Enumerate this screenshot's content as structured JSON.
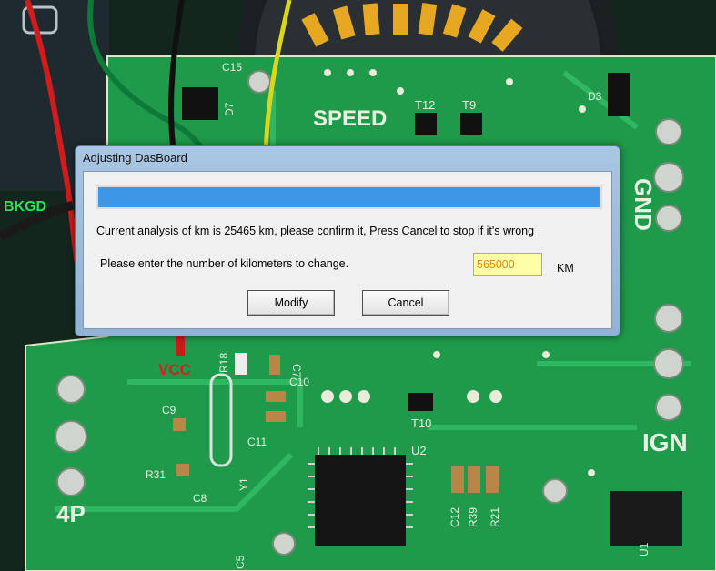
{
  "background": {
    "labels": {
      "speed": "SPEED",
      "gnd": "GND",
      "ign": "IGN",
      "bkgd": "BKGD",
      "vcc": "VCC",
      "four_p": "4P",
      "c15": "C15",
      "d7": "D7",
      "t12": "T12",
      "t9": "T9",
      "d3": "D3",
      "r18": "R18",
      "c7": "C7",
      "c10": "C10",
      "c9": "C9",
      "c11": "C11",
      "r31": "R31",
      "c8": "C8",
      "y1": "Y1",
      "t10": "T10",
      "u2": "U2",
      "c12": "C12",
      "r39": "R39",
      "r21": "R21",
      "u1": "U1",
      "c5": "C5"
    }
  },
  "dialog": {
    "title": "Adjusting DasBoard",
    "progress_fraction": 1.0,
    "message": "Current analysis of km is 25465 km, please confirm it, Press Cancel to stop if it's wrong",
    "prompt": "Please enter the number of kilometers to change.",
    "km_value": "565000",
    "km_unit": "KM",
    "modify_label": "Modify",
    "cancel_label": "Cancel"
  }
}
